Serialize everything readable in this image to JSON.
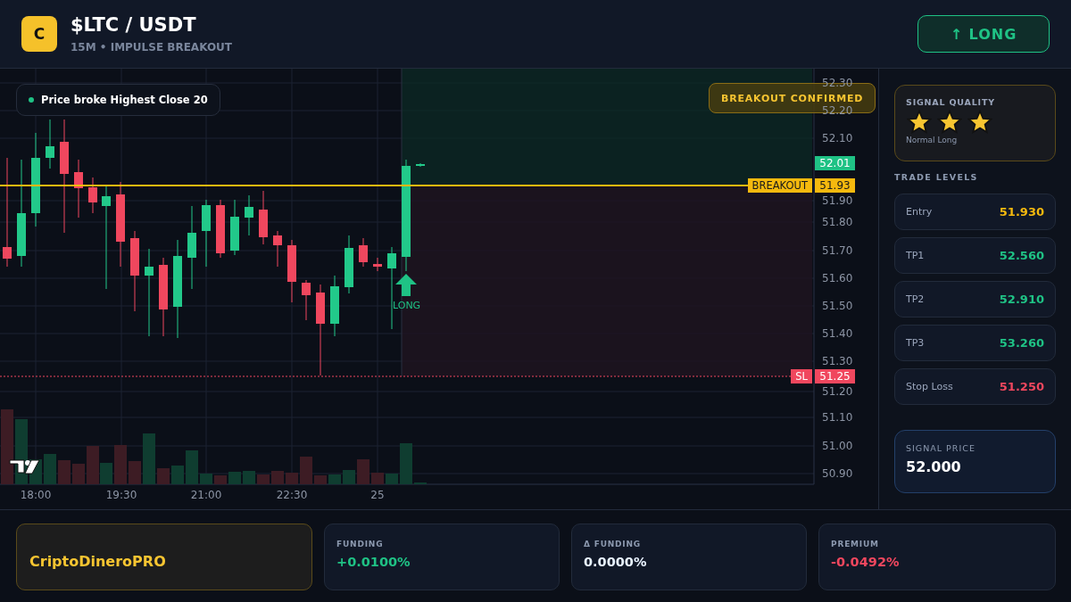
{
  "header": {
    "logo_letter": "C",
    "title": "$LTC / USDT",
    "subtitle": "15M • IMPULSE BREAKOUT",
    "direction_button": "↑ LONG"
  },
  "chart": {
    "signal_note": "Price broke Highest Close 20",
    "status_badge": "BREAKOUT CONFIRMED",
    "price_ticks": [
      "52.30",
      "52.20",
      "52.10",
      "51.90",
      "51.80",
      "51.70",
      "51.60",
      "51.50",
      "51.40",
      "51.30",
      "51.20",
      "51.10",
      "51.00",
      "50.90"
    ],
    "time_ticks": [
      "18:00",
      "19:30",
      "21:00",
      "22:30",
      "25"
    ],
    "price_tags": [
      {
        "kind": "last",
        "value": "52.01"
      },
      {
        "kind": "breakout",
        "label": "BREAKOUT",
        "value": "51.93"
      },
      {
        "kind": "stop",
        "label": "SL",
        "value": "51.25"
      }
    ],
    "entry_marker": "LONG"
  },
  "signal_quality": {
    "title": "SIGNAL QUALITY",
    "stars": 3,
    "caption": "Normal Long"
  },
  "trade_levels": {
    "title": "TRADE LEVELS",
    "rows": [
      {
        "kind": "entry",
        "label": "Entry",
        "value": "51.930"
      },
      {
        "kind": "target",
        "label": "TP1",
        "value": "52.560"
      },
      {
        "kind": "target",
        "label": "TP2",
        "value": "52.910"
      },
      {
        "kind": "target",
        "label": "TP3",
        "value": "53.260"
      },
      {
        "kind": "stop",
        "label": "Stop Loss",
        "value": "51.250"
      }
    ]
  },
  "signal_price": {
    "label": "SIGNAL PRICE",
    "value": "52.000"
  },
  "footer": {
    "brand": "CriptoDineroPRO",
    "stats": [
      {
        "kind": "positive",
        "label": "FUNDING",
        "value": "+0.0100%"
      },
      {
        "kind": "neutral",
        "label": "Δ FUNDING",
        "value": "0.0000%"
      },
      {
        "kind": "negative",
        "label": "PREMIUM",
        "value": "-0.0492%"
      }
    ]
  }
}
